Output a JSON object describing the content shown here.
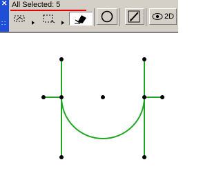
{
  "window": {
    "close_glyph": "✕",
    "grip_glyph": "∷"
  },
  "status": {
    "selection_text": "All Selected: 5"
  },
  "toolbar": {
    "tools": [
      {
        "name": "marquee-tool",
        "icon": "marquee-icon"
      },
      {
        "name": "rectangle-select-tool",
        "icon": "dashed-rectangle-icon"
      },
      {
        "name": "eraser-tool",
        "icon": "eraser-icon"
      },
      {
        "name": "circle-tool",
        "icon": "circle-icon"
      },
      {
        "name": "pen-tool",
        "icon": "pen-icon"
      },
      {
        "name": "view-2d-button",
        "icon": "eye-icon"
      }
    ],
    "view_2d_label": "2D"
  },
  "canvas": {
    "stroke_color": "#22a522",
    "point_color": "#000000",
    "shape": "u-shaped wall with arc",
    "selected_count": 5
  }
}
